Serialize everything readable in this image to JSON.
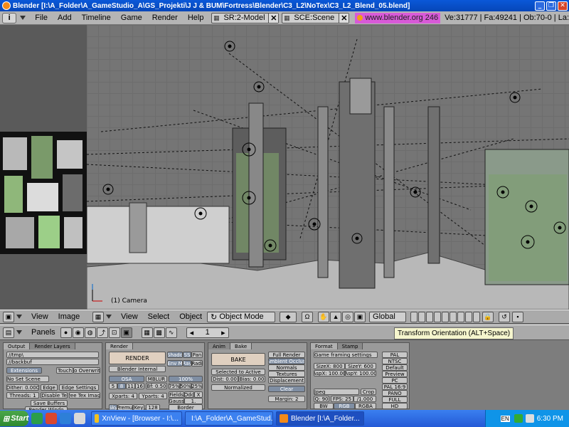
{
  "window": {
    "title": "Blender [I:\\A_Folder\\A_GameStudio_A\\GS_Projekti\\J J & BUM\\Fortress\\Blender\\C3_L2\\NoTex\\C3_L2_Blend_05.blend]"
  },
  "menubar": {
    "info_icon": "i",
    "menus": [
      "File",
      "Add",
      "Timeline",
      "Game",
      "Render",
      "Help"
    ],
    "screen": "SR:2-Model",
    "scene": "SCE:Scene",
    "url": "www.blender.org 246",
    "stats": "Ve:31777 | Fa:49241 | Ob:70-0 | La:"
  },
  "viewport": {
    "label": "(1) Camera"
  },
  "image_header": {
    "menus": [
      "View",
      "Image"
    ]
  },
  "view3d_header": {
    "menus": [
      "View",
      "Select",
      "Object"
    ],
    "mode": "Object Mode",
    "orientation": "Global"
  },
  "buttons_header": {
    "panels_label": "Panels",
    "frame": "1"
  },
  "tooltip": "Transform Orientation (ALT+Space)",
  "panels": {
    "output": {
      "tabs": [
        "Output",
        "Render Layers"
      ],
      "paths": [
        "//tmp\\",
        "//backbuf"
      ],
      "extensions": "Extensions",
      "touch": "Touch",
      "no_overwrite": "No Overwrite",
      "no_set_scene": "No Set Scene",
      "dither": "Dither: 0.000",
      "edge": "Edge",
      "edge_settings": "Edge Settings",
      "threads": "Threads: 1",
      "disable_tex": "Disable Te",
      "free_tex": "Free Tex Image",
      "save_buffers": "Save Buffers",
      "render_window": "Render Windo"
    },
    "render": {
      "tabs": [
        "Render"
      ],
      "render_button": "RENDER",
      "engine": "Blender Internal",
      "shadow": "Shado",
      "ss": "SS",
      "pano": "Pan",
      "envmap": "Env M",
      "ray": "Ray",
      "radio": "Radi",
      "osa": "OSA",
      "mblur": "MBLUR",
      "pct100": "100%",
      "osa_vals": [
        "5",
        "8",
        "11",
        "16"
      ],
      "bf": "Bf: 0.50",
      "pcts": [
        "75%",
        "50%",
        "25%"
      ],
      "xparts": "Xparts: 4",
      "yparts": "Yparts: 4",
      "fields": "Fields",
      "odd": "Odd",
      "x": "X",
      "gauss": "Gauss",
      "gauss_val": "1.",
      "sky": "Sky",
      "premul": "Premul",
      "key": "Key",
      "val128": "128",
      "border": "Border"
    },
    "anim_bake": {
      "tabs": [
        "Anim",
        "Bake"
      ],
      "bake_button": "BAKE",
      "selected_to_active": "Selected to Active",
      "dist": "Dist: 0.00",
      "bias": "Bias: 0.00",
      "normalized": "Normalized",
      "modes": [
        "Full Render",
        "Ambient Occlusi",
        "Normals",
        "Textures",
        "Displacement"
      ],
      "clear": "Clear",
      "margin": "Margin: 2"
    },
    "format": {
      "tabs": [
        "Format",
        "Stamp"
      ],
      "preset_label": "Game framing settings",
      "sizex": "SizeX: 800",
      "sizey": "SizeY: 600",
      "aspx": "AspX: 100.00",
      "aspy": "AspY: 100.00",
      "codec": "Jpeg",
      "crop": "Crop",
      "q": "Q: 90",
      "fps": "FPS: 25",
      "fps_div": "/1.000",
      "bw": "BW",
      "rgb": "RGB",
      "rgba": "RGBA",
      "presets": [
        "PAL",
        "NTSC",
        "Default",
        "Preview",
        "PC",
        "PAL 16:9",
        "PANO",
        "FULL",
        "HD"
      ]
    }
  },
  "taskbar": {
    "start": "Start",
    "tasks": [
      "XnView - [Browser - I:\\...",
      "I:\\A_Folder\\A_GameStud...",
      "Blender [I:\\A_Folder..."
    ],
    "lang": "EN",
    "time": "6:30 PM"
  },
  "colors": {
    "titlebar": "#0a58d8",
    "url_bg": "#d85ad8",
    "taskbar": "#245ad6",
    "start": "#3a963a"
  }
}
